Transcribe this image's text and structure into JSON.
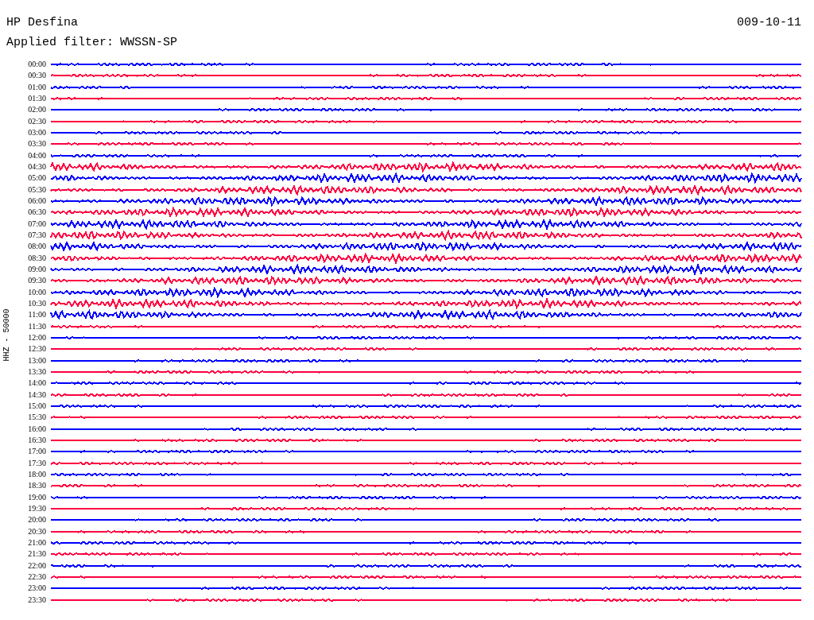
{
  "title": "HP Desfina",
  "date": "009-10-11",
  "filter": {
    "label": "Applied filter:",
    "value": "WWSSN-SP"
  },
  "channel_label": "HHZ - 50000",
  "rows": [
    {
      "time": "00:00",
      "color": "#0000ff"
    },
    {
      "time": "00:30",
      "color": "#ff0040"
    },
    {
      "time": "01:00",
      "color": "#0000ff"
    },
    {
      "time": "01:30",
      "color": "#ff0040"
    },
    {
      "time": "02:00",
      "color": "#0000ff"
    },
    {
      "time": "02:30",
      "color": "#ff0040"
    },
    {
      "time": "03:00",
      "color": "#0000ff"
    },
    {
      "time": "03:30",
      "color": "#ff0040"
    },
    {
      "time": "04:00",
      "color": "#0000ff"
    },
    {
      "time": "04:30",
      "color": "#ff0040"
    },
    {
      "time": "05:00",
      "color": "#0000ff"
    },
    {
      "time": "05:30",
      "color": "#ff0040"
    },
    {
      "time": "06:00",
      "color": "#0000ff"
    },
    {
      "time": "06:30",
      "color": "#ff0040"
    },
    {
      "time": "07:00",
      "color": "#0000ff"
    },
    {
      "time": "07:30",
      "color": "#ff0040"
    },
    {
      "time": "08:00",
      "color": "#0000ff"
    },
    {
      "time": "08:30",
      "color": "#ff0040"
    },
    {
      "time": "09:00",
      "color": "#0000ff"
    },
    {
      "time": "09:30",
      "color": "#ff0040"
    },
    {
      "time": "10:00",
      "color": "#0000ff"
    },
    {
      "time": "10:30",
      "color": "#ff0040"
    },
    {
      "time": "11:00",
      "color": "#0000ff"
    },
    {
      "time": "11:30",
      "color": "#ff0040"
    },
    {
      "time": "12:00",
      "color": "#0000ff"
    },
    {
      "time": "12:30",
      "color": "#ff0040"
    },
    {
      "time": "13:00",
      "color": "#0000ff"
    },
    {
      "time": "13:30",
      "color": "#ff0040"
    },
    {
      "time": "14:00",
      "color": "#0000ff"
    },
    {
      "time": "14:30",
      "color": "#ff0040"
    },
    {
      "time": "15:00",
      "color": "#0000ff"
    },
    {
      "time": "15:30",
      "color": "#ff0040"
    },
    {
      "time": "16:00",
      "color": "#0000ff"
    },
    {
      "time": "16:30",
      "color": "#ff0040"
    },
    {
      "time": "17:00",
      "color": "#0000ff"
    },
    {
      "time": "17:30",
      "color": "#ff0040"
    },
    {
      "time": "18:00",
      "color": "#0000ff"
    },
    {
      "time": "18:30",
      "color": "#ff0040"
    },
    {
      "time": "19:00",
      "color": "#0000ff"
    },
    {
      "time": "19:30",
      "color": "#ff0040"
    },
    {
      "time": "20:00",
      "color": "#0000ff"
    },
    {
      "time": "20:30",
      "color": "#ff0040"
    },
    {
      "time": "21:00",
      "color": "#0000ff"
    },
    {
      "time": "21:30",
      "color": "#ff0040"
    },
    {
      "time": "22:00",
      "color": "#0000ff"
    },
    {
      "time": "22:30",
      "color": "#ff0040"
    },
    {
      "time": "23:00",
      "color": "#0000ff"
    },
    {
      "time": "23:30",
      "color": "#ff0040"
    }
  ]
}
